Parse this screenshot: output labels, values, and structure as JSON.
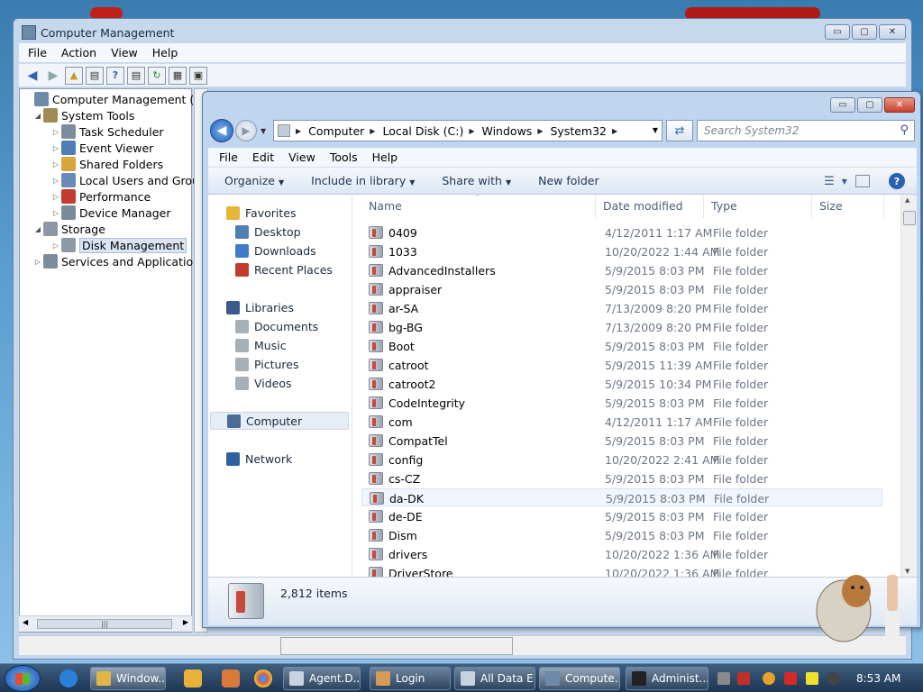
{
  "computer_management": {
    "title": "Computer Management",
    "caption_buttons": {
      "minimize": "▭",
      "maximize": "▢",
      "close": "✕"
    },
    "menu": [
      "File",
      "Action",
      "View",
      "Help"
    ],
    "tree": [
      {
        "label": "Computer Management (Local",
        "level": 0,
        "icon": "computer-management-icon"
      },
      {
        "label": "System Tools",
        "level": 1,
        "icon": "system-tools-icon",
        "expanded": true
      },
      {
        "label": "Task Scheduler",
        "level": 2,
        "icon": "task-scheduler-icon"
      },
      {
        "label": "Event Viewer",
        "level": 2,
        "icon": "event-viewer-icon"
      },
      {
        "label": "Shared Folders",
        "level": 2,
        "icon": "shared-folders-icon"
      },
      {
        "label": "Local Users and Groups",
        "level": 2,
        "icon": "users-icon"
      },
      {
        "label": "Performance",
        "level": 2,
        "icon": "performance-icon"
      },
      {
        "label": "Device Manager",
        "level": 2,
        "icon": "device-manager-icon"
      },
      {
        "label": "Storage",
        "level": 1,
        "icon": "storage-icon",
        "expanded": true
      },
      {
        "label": "Disk Management",
        "level": 2,
        "icon": "disk-management-icon",
        "selected": true
      },
      {
        "label": "Services and Applications",
        "level": 1,
        "icon": "services-icon"
      }
    ]
  },
  "explorer": {
    "caption_buttons": {
      "minimize": "▭",
      "maximize": "▢",
      "close": "✕"
    },
    "breadcrumb": [
      "Computer",
      "Local Disk (C:)",
      "Windows",
      "System32"
    ],
    "search_placeholder": "Search System32",
    "menu": [
      "File",
      "Edit",
      "View",
      "Tools",
      "Help"
    ],
    "commands": [
      "Organize",
      "Include in library",
      "Share with",
      "New folder"
    ],
    "nav": {
      "favorites": {
        "label": "Favorites",
        "items": [
          "Desktop",
          "Downloads",
          "Recent Places"
        ]
      },
      "libraries": {
        "label": "Libraries",
        "items": [
          "Documents",
          "Music",
          "Pictures",
          "Videos"
        ]
      },
      "computer": "Computer",
      "network": "Network"
    },
    "columns": [
      "Name",
      "Date modified",
      "Type",
      "Size"
    ],
    "files": [
      {
        "name": "0409",
        "date": "4/12/2011 1:17 AM",
        "type": "File folder"
      },
      {
        "name": "1033",
        "date": "10/20/2022 1:44 AM",
        "type": "File folder"
      },
      {
        "name": "AdvancedInstallers",
        "date": "5/9/2015 8:03 PM",
        "type": "File folder"
      },
      {
        "name": "appraiser",
        "date": "5/9/2015 8:03 PM",
        "type": "File folder"
      },
      {
        "name": "ar-SA",
        "date": "7/13/2009 8:20 PM",
        "type": "File folder"
      },
      {
        "name": "bg-BG",
        "date": "7/13/2009 8:20 PM",
        "type": "File folder"
      },
      {
        "name": "Boot",
        "date": "5/9/2015 8:03 PM",
        "type": "File folder"
      },
      {
        "name": "catroot",
        "date": "5/9/2015 11:39 AM",
        "type": "File folder"
      },
      {
        "name": "catroot2",
        "date": "5/9/2015 10:34 PM",
        "type": "File folder"
      },
      {
        "name": "CodeIntegrity",
        "date": "5/9/2015 8:03 PM",
        "type": "File folder"
      },
      {
        "name": "com",
        "date": "4/12/2011 1:17 AM",
        "type": "File folder"
      },
      {
        "name": "CompatTel",
        "date": "5/9/2015 8:03 PM",
        "type": "File folder"
      },
      {
        "name": "config",
        "date": "10/20/2022 2:41 AM",
        "type": "File folder"
      },
      {
        "name": "cs-CZ",
        "date": "5/9/2015 8:03 PM",
        "type": "File folder"
      },
      {
        "name": "da-DK",
        "date": "5/9/2015 8:03 PM",
        "type": "File folder",
        "hover": true
      },
      {
        "name": "de-DE",
        "date": "5/9/2015 8:03 PM",
        "type": "File folder"
      },
      {
        "name": "Dism",
        "date": "5/9/2015 8:03 PM",
        "type": "File folder"
      },
      {
        "name": "drivers",
        "date": "10/20/2022 1:36 AM",
        "type": "File folder"
      },
      {
        "name": "DriverStore",
        "date": "10/20/2022 1:36 AM",
        "type": "File folder"
      }
    ],
    "item_count": "2,812 items"
  },
  "taskbar": {
    "buttons": [
      {
        "label": "Window...",
        "icon": "explorer-folder-icon",
        "active": true
      },
      {
        "label": "Agent.D...",
        "icon": "window-icon"
      },
      {
        "label": "Login",
        "icon": "login-icon"
      },
      {
        "label": "All Data E...",
        "icon": "window-icon"
      },
      {
        "label": "Compute...",
        "icon": "computer-management-icon",
        "active": true
      },
      {
        "label": "Administ...",
        "icon": "cmd-icon"
      }
    ],
    "clock": "8:53 AM"
  },
  "colors": {
    "accent": "#2a5fb2",
    "close_red": "#c4412c",
    "folder_red": "#c8483a"
  }
}
